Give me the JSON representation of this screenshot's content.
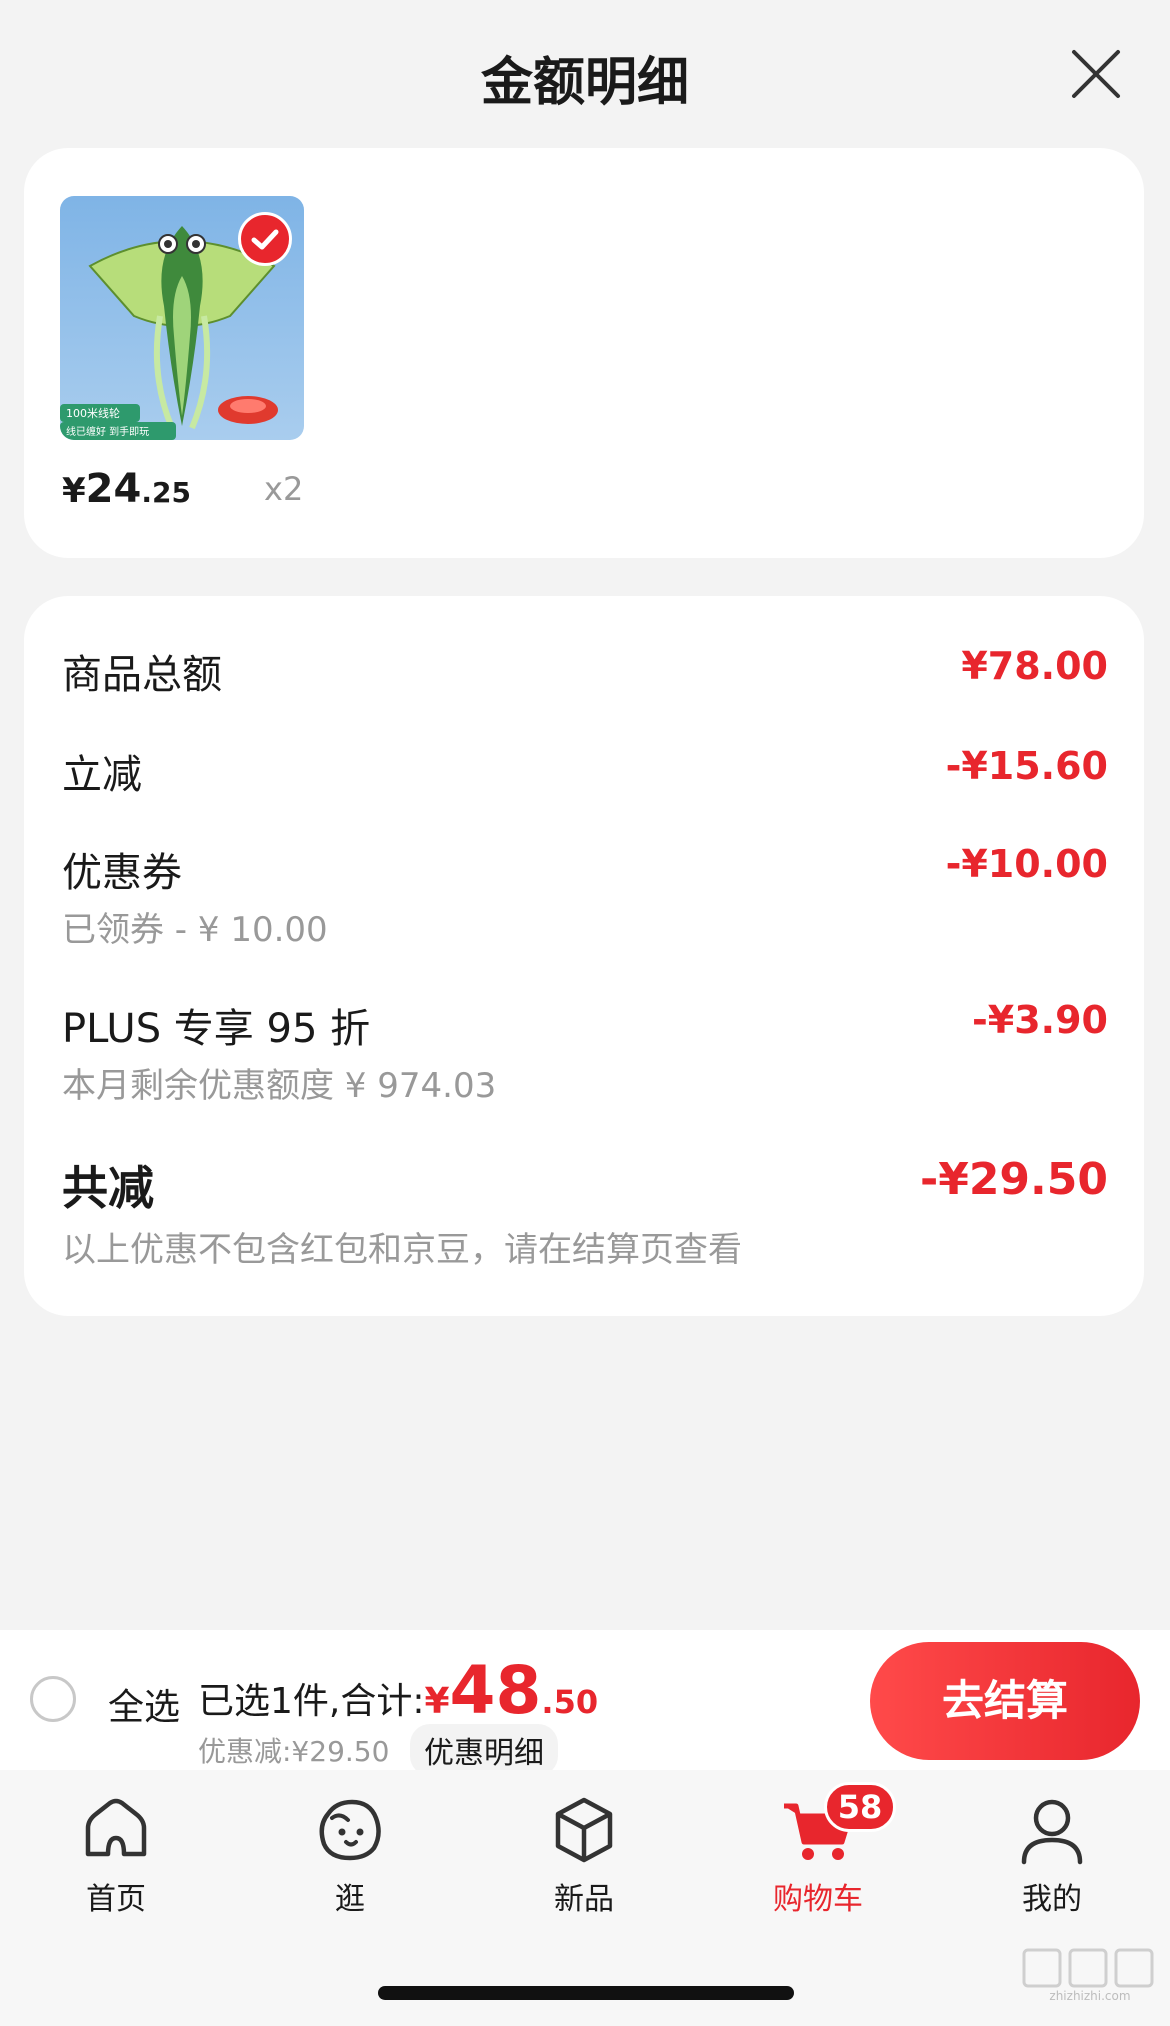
{
  "header": {
    "title": "金额明细"
  },
  "product": {
    "price_currency": "¥",
    "price_int": "24",
    "price_dec": ".25",
    "qty": "x2",
    "image_tag_1": "100米线轮",
    "image_tag_2": "线已缠好 到手即玩"
  },
  "breakdown": {
    "rows": [
      {
        "label": "商品总额",
        "amount": "¥78.00"
      },
      {
        "label": "立减",
        "amount": "-¥15.60"
      },
      {
        "label": "优惠券",
        "sub": "已领券 - ¥ 10.00",
        "amount": "-¥10.00"
      },
      {
        "label": "PLUS 专享 95 折",
        "sub": "本月剩余优惠额度  ¥ 974.03",
        "amount": "-¥3.90"
      }
    ],
    "total": {
      "label": "共减",
      "amount": "-¥29.50",
      "note": "以上优惠不包含红包和京豆，请在结算页查看"
    }
  },
  "checkout": {
    "select_all": "全选",
    "selected_text": "已选1件,合计:",
    "total_currency": "¥",
    "total_int": "48",
    "total_dec": ".50",
    "discount_text": "优惠减:¥29.50",
    "detail_chip": "优惠明细",
    "button": "去结算"
  },
  "tabbar": {
    "items": [
      {
        "label": "首页",
        "icon": "home-icon"
      },
      {
        "label": "逛",
        "icon": "face-icon"
      },
      {
        "label": "新品",
        "icon": "cube-icon"
      },
      {
        "label": "购物车",
        "icon": "cart-icon",
        "active": true
      },
      {
        "label": "我的",
        "icon": "user-icon"
      }
    ],
    "cart_badge": "58"
  },
  "watermark": {
    "text": "zhizhizhi.com"
  },
  "colors": {
    "accent": "#e8262d",
    "muted": "#999999",
    "background": "#f3f3f3"
  }
}
